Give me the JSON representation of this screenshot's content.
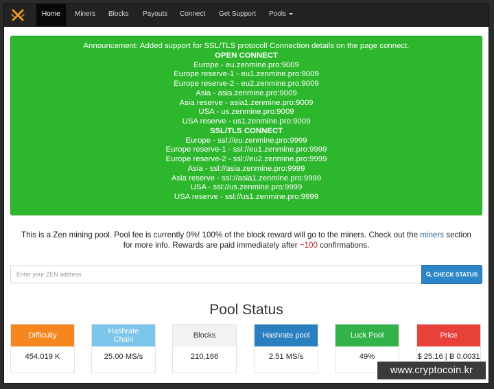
{
  "nav": {
    "items": [
      {
        "label": "Home",
        "active": true
      },
      {
        "label": "Miners"
      },
      {
        "label": "Blocks"
      },
      {
        "label": "Payouts"
      },
      {
        "label": "Connect"
      },
      {
        "label": "Get Support"
      },
      {
        "label": "Pools"
      }
    ]
  },
  "announcement": {
    "lines": [
      "Announcement: Added support for SSL/TLS protocol! Connection details on the page connect.",
      "OPEN CONNECT",
      "Europe - eu.zenmine.pro:9009",
      "Europe reserve-1 - eu1.zenmine.pro:9009",
      "Europe reserve-2 - eu2.zenmine.pro:9009",
      "Asia - asia.zenmine.pro:9009",
      "Asia reserve - asia1.zenmine.pro:9009",
      "USA - us.zenmine.pro:9009",
      "USA reserve - us1.zenmine.pro:9009",
      "SSL/TLS CONNECT",
      "Europe - ssl://eu.zenmine.pro:9999",
      "Europe reserve-1 - ssl://eu1.zenmine.pro:9999",
      "Europe reserve-2 - ssl://eu2.zenmine.pro:9999",
      "Asia - ssl://asia.zenmine.pro:9999",
      "Asia reserve - ssl://asia1.zenmine.pro:9999",
      "USA - ssl://us.zenmine.pro:9999",
      "USA reserve - ssl://us1.zenmine.pro:9999"
    ]
  },
  "intro": {
    "part1": "This is a Zen mining pool. Pool fee is currently 0%! 100% of the block reward will go to the miners. Check out the ",
    "miners_link": "miners",
    "part2": " section",
    "part3": "for more info. Rewards are paid immediately after ",
    "confirmations_value": "~100",
    "part4": " confirmations."
  },
  "search": {
    "placeholder": "Enter your ZEN address",
    "button_label": "CHECK STATUS"
  },
  "pool_status": {
    "title": "Pool Status",
    "cards": [
      {
        "label": "Difficulty",
        "value": "454.019 K"
      },
      {
        "label": "Hashrate Chain",
        "value": "25.00 MS/s"
      },
      {
        "label": "Blocks",
        "value": "210,166"
      },
      {
        "label": "Hashrate pool",
        "value": "2.51 MS/s"
      },
      {
        "label": "Luck Pool",
        "value": "49%"
      },
      {
        "label": "Price",
        "value": "$ 25.16 | Ƀ 0.0031"
      }
    ]
  },
  "watermark": "www.cryptocoin.kr",
  "colors": {
    "navbar": "#222222",
    "announcement": "#2db72d",
    "button": "#2c86c8",
    "difficulty": "#f6871f",
    "hashrate_chain": "#7cc5ea",
    "blocks": "#f2f2f2",
    "hashrate_pool": "#2a7fbf",
    "luck_pool": "#33b24a",
    "price": "#e8413a"
  }
}
